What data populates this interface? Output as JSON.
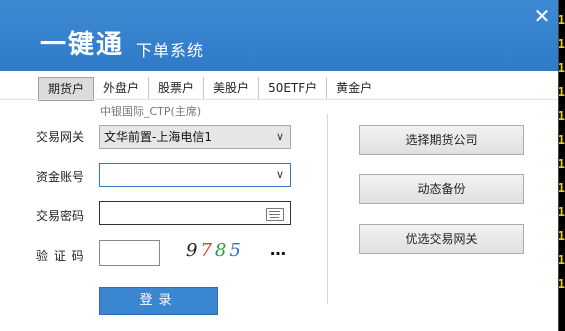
{
  "app": {
    "logo_main": "一键通",
    "logo_sub": "下单系统",
    "close": "✕"
  },
  "tabs": [
    {
      "label": "期货户",
      "active": true
    },
    {
      "label": "外盘户"
    },
    {
      "label": "股票户"
    },
    {
      "label": "美股户"
    },
    {
      "label": "50ETF户"
    },
    {
      "label": "黄金户"
    }
  ],
  "server_label": "中银国际_CTP(主席)",
  "form": {
    "gateway_label": "交易网关",
    "gateway_value": "文华前置-上海电信1",
    "account_label": "资金账号",
    "account_value": "",
    "password_label": "交易密码",
    "captcha_label": "验 证 码",
    "captcha_digits": [
      "9",
      "7",
      "8",
      "5"
    ],
    "captcha_colors": [
      "#222222",
      "#d83a22",
      "#2a9a3a",
      "#2c6fd1"
    ],
    "more_label": "…",
    "login_label": "登录"
  },
  "right_buttons": {
    "choose_company": "选择期货公司",
    "dynamic_backup": "动态备份",
    "preferred_gateway": "优选交易网关"
  },
  "background_digits": [
    "1",
    "1",
    "1",
    "1",
    "1",
    "1",
    "1",
    "1",
    "1",
    "1",
    "1",
    "1"
  ],
  "colors": {
    "titlebar": "#2f7bc8",
    "login_button": "#3a86d0",
    "background_digits": "#e8d400"
  }
}
